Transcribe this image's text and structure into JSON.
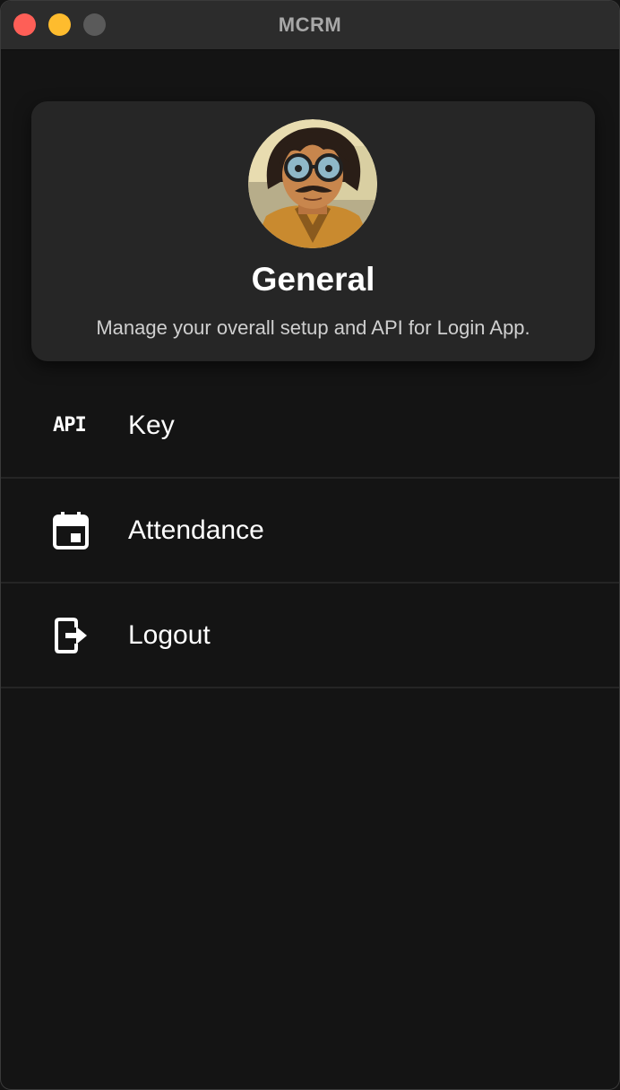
{
  "window": {
    "title": "MCRM"
  },
  "profile": {
    "title": "General",
    "description": "Manage your overall setup and API for Login App."
  },
  "menu": {
    "items": [
      {
        "icon_text": "API",
        "label": "Key",
        "icon": "api-icon"
      },
      {
        "label": "Attendance",
        "icon": "calendar-icon"
      },
      {
        "label": "Logout",
        "icon": "logout-icon"
      }
    ]
  },
  "colors": {
    "background": "#141414",
    "card": "#262626",
    "titlebar": "#2c2c2c",
    "close": "#fe5f57",
    "minimize": "#febc2e",
    "maximize": "#5a5a5a"
  }
}
